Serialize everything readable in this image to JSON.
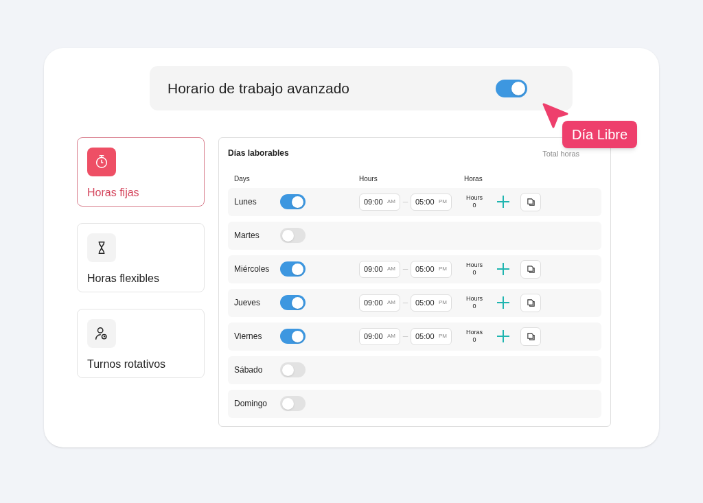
{
  "header": {
    "title": "Horario de trabajo avanzado",
    "on": true
  },
  "callout": {
    "label": "Día Libre"
  },
  "modes": [
    {
      "label": "Horas fijas",
      "selected": true
    },
    {
      "label": "Horas flexibles",
      "selected": false
    },
    {
      "label": "Turnos rotativos",
      "selected": false
    }
  ],
  "schedule": {
    "title": "Días laborables",
    "total_label": "Total horas",
    "columns": [
      "Days",
      "Hours",
      "Horas"
    ],
    "rows": [
      {
        "day": "Lunes",
        "on": true,
        "start": "09:00",
        "start_period": "AM",
        "end": "05:00",
        "end_period": "PM",
        "hours_label": "Hours",
        "hours": "0"
      },
      {
        "day": "Martes",
        "on": false
      },
      {
        "day": "Miércoles",
        "on": true,
        "start": "09:00",
        "start_period": "AM",
        "end": "05:00",
        "end_period": "PM",
        "hours_label": "Hours",
        "hours": "0"
      },
      {
        "day": "Jueves",
        "on": true,
        "start": "09:00",
        "start_period": "AM",
        "end": "05:00",
        "end_period": "PM",
        "hours_label": "Hours",
        "hours": "0"
      },
      {
        "day": "Viernes",
        "on": true,
        "start": "09:00",
        "start_period": "AM",
        "end": "05:00",
        "end_period": "PM",
        "hours_label": "Horas",
        "hours": "0"
      },
      {
        "day": "Sábado",
        "on": false
      },
      {
        "day": "Domingo",
        "on": false
      }
    ]
  }
}
